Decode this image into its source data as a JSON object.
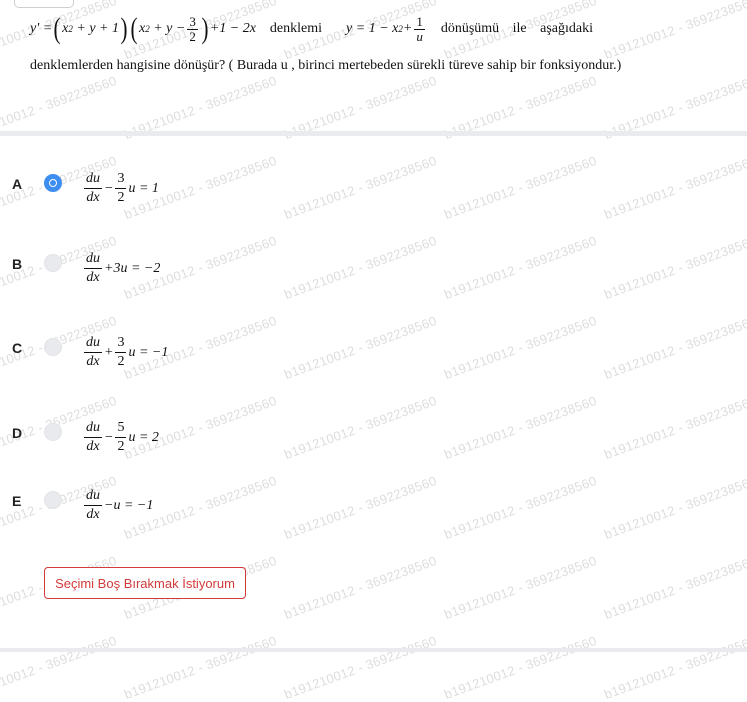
{
  "question": {
    "equation_prefix": "y' =",
    "equation_suffix": "+1 − 2x",
    "word_denklemi": "denklemi",
    "transform_prefix": "y = 1 − x",
    "transform_suffix": "+",
    "word_donusumu": "dönüşümü ile aşağıdaki",
    "text": "denklemlerden hangisine dönüşür? ( Burada  u , birinci mertebeden sürekli türeve sahip bir fonksiyondur.)"
  },
  "options": [
    {
      "letter": "A",
      "selected": true,
      "sign": "−",
      "coef_num": "3",
      "coef_den": "2",
      "tail": "u = 1"
    },
    {
      "letter": "B",
      "selected": false,
      "sign": "+",
      "coef_num": "",
      "coef_den": "",
      "tail": "3u = −2"
    },
    {
      "letter": "C",
      "selected": false,
      "sign": "+",
      "coef_num": "3",
      "coef_den": "2",
      "tail": "u = −1"
    },
    {
      "letter": "D",
      "selected": false,
      "sign": "−",
      "coef_num": "5",
      "coef_den": "2",
      "tail": "u = 2"
    },
    {
      "letter": "E",
      "selected": false,
      "sign": "−",
      "coef_num": "",
      "coef_den": "",
      "tail": "u = −1"
    }
  ],
  "skip_button": "Seçimi Boş Bırakmak İstiyorum",
  "watermark": "b191210012 - 3692238560",
  "colors": {
    "accent": "#3d8ef0",
    "skip": "#d33a3a"
  }
}
